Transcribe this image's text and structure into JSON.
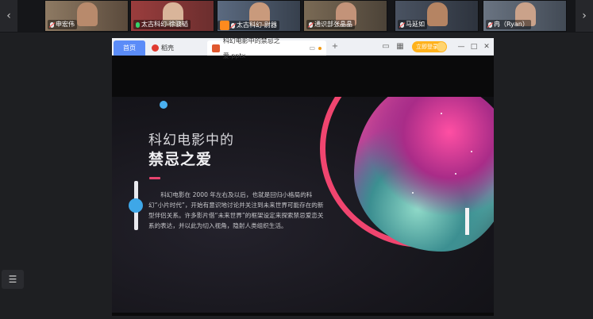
{
  "participants": [
    {
      "name": "申宏伟",
      "mic": "off",
      "bg": "#6b5a4a"
    },
    {
      "name": "太古科幻-徐骁韬",
      "mic": "on",
      "bg": "#8a3a3a"
    },
    {
      "name": "太古科幻-尉器",
      "mic": "off",
      "badge": true,
      "bg": "#4a5566"
    },
    {
      "name": "通识部张晶晶",
      "mic": "off",
      "bg": "#5a5047"
    },
    {
      "name": "马延如",
      "mic": "off",
      "bg": "#3f4654"
    },
    {
      "name": "冉（Ryan）",
      "mic": "off",
      "bg": "#505a66"
    }
  ],
  "nav": {
    "left": "‹",
    "right": "›"
  },
  "window": {
    "tab_home": "首页",
    "tab_shell": "稻壳",
    "tab_file": "科幻电影中的禁忌之爱.pptx",
    "new_tab": "+",
    "login": "立即登录",
    "minimize": "—",
    "maximize": "□",
    "close": "✕"
  },
  "slide": {
    "title_line1": "科幻电影中的",
    "title_line2": "禁忌之爱",
    "body": "科幻电影在 2000 年左右及以后，也就是回归小格局的科幻“小片时代”，开始有意识地讨论并关注到未来世界可能存在的新型伴侣关系。许多影片借“未来世界”的框架设定来探索禁忌爱恋关系的表达，并以此为切入视角，隐射人类组织生活。"
  },
  "sidebar": {
    "list_icon": "☰"
  }
}
